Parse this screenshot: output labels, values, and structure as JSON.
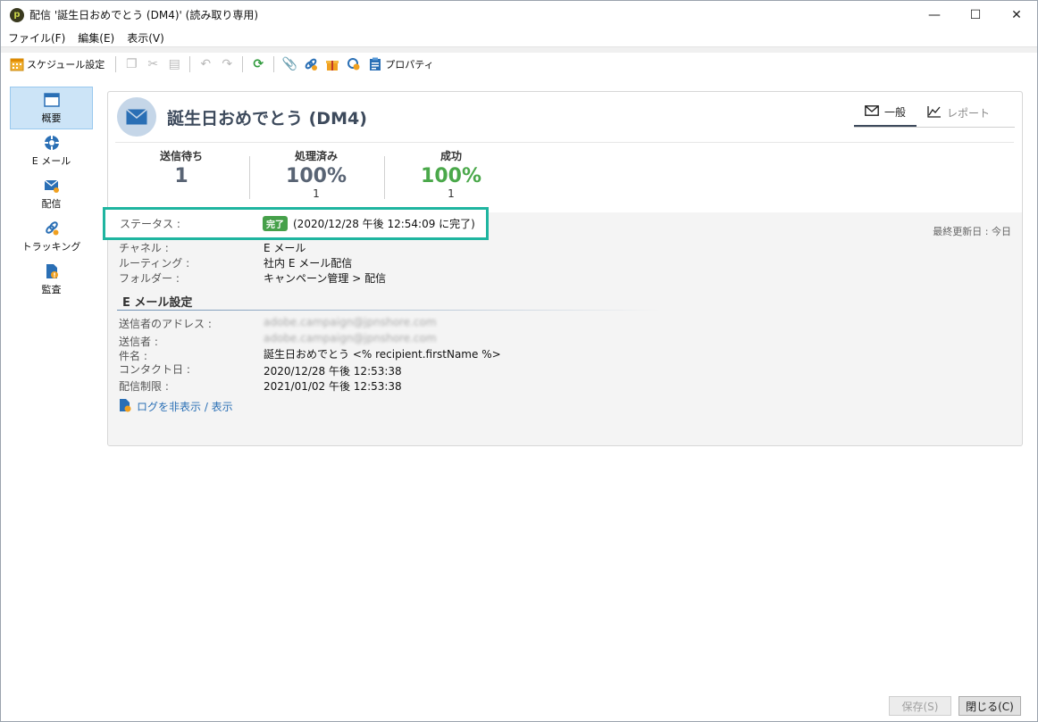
{
  "window": {
    "title": "配信 '誕生日おめでとう (DM4)' (読み取り専用)",
    "controls": {
      "minimize": "—",
      "maximize": "☐",
      "close": "✕"
    }
  },
  "menu": [
    "ファイル(F)",
    "編集(E)",
    "表示(V)"
  ],
  "toolbar": {
    "schedule_label": "スケジュール設定",
    "properties_label": "プロパティ"
  },
  "nav": [
    {
      "label": "概要",
      "icon": "overview-icon"
    },
    {
      "label": "E メール",
      "icon": "email-icon"
    },
    {
      "label": "配信",
      "icon": "delivery-icon"
    },
    {
      "label": "トラッキング",
      "icon": "tracking-icon"
    },
    {
      "label": "監査",
      "icon": "audit-icon"
    }
  ],
  "header": {
    "title": "誕生日おめでとう (DM4)",
    "tabs": [
      {
        "label": "一般"
      },
      {
        "label": "レポート"
      }
    ]
  },
  "metrics": [
    {
      "label": "送信待ち",
      "value": "1",
      "sub": ""
    },
    {
      "label": "処理済み",
      "value": "100%",
      "sub": "1"
    },
    {
      "label": "成功",
      "value": "100%",
      "sub": "1"
    }
  ],
  "info": {
    "status_label": "ステータス :",
    "status_badge": "完了",
    "status_value": "(2020/12/28 午後 12:54:09 に完了)",
    "channel_label": "チャネル :",
    "channel_value": "E メール",
    "routing_label": "ルーティング :",
    "routing_value": "社内 E メール配信",
    "folder_label": "フォルダー :",
    "folder_value": "キャンペーン管理 > 配信",
    "last_updated": "最終更新日 : 今日"
  },
  "email_settings": {
    "title": "E メール設定",
    "sender_address_label": "送信者のアドレス :",
    "sender_address_value": "adobe.campaign@jpnshore.com",
    "sender_label": "送信者 :",
    "sender_value": "adobe.campaign@jpnshore.com",
    "subject_label": "件名 :",
    "subject_value": "誕生日おめでとう <% recipient.firstName %>",
    "contact_date_label": "コンタクト日 :",
    "contact_date_value": "2020/12/28 午後 12:53:38",
    "limit_label": "配信制限 :",
    "limit_value": "2021/01/02 午後 12:53:38",
    "log_link": "ログを非表示 / 表示"
  },
  "footer": {
    "save": "保存(S)",
    "close": "閉じる(C)"
  },
  "colors": {
    "highlight": "#1fb5a0",
    "success": "#4aa84a",
    "title": "#3d4a5c"
  }
}
